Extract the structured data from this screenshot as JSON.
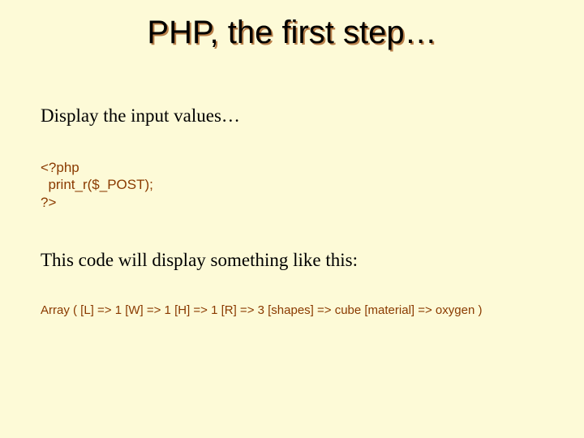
{
  "title": "PHP, the first step…",
  "intro": "Display the input values…",
  "code": "<?php\n  print_r($_POST);\n?>",
  "explain": "This code will display something like this:",
  "output": "Array ( [L] => 1 [W] => 1 [H] => 1 [R] => 3 [shapes] => cube [material] => oxygen )"
}
